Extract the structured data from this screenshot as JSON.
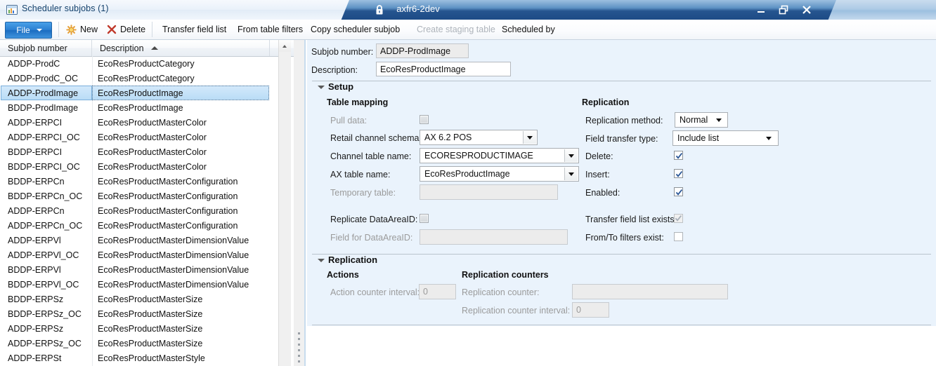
{
  "window": {
    "inner_title": "Scheduler subjobs (1)",
    "document_title": "axfr6-2dev",
    "icons": {
      "app": "window-icon",
      "lock": "lock-icon",
      "minimize": "minimize-icon",
      "maximize": "maximize-icon",
      "close": "close-icon"
    }
  },
  "toolbar": {
    "file_label": "File",
    "items": [
      {
        "label": "New",
        "icon": "new-star-icon",
        "disabled": false
      },
      {
        "label": "Delete",
        "icon": "delete-x-icon",
        "disabled": false
      },
      {
        "label": "Transfer field list",
        "icon": "",
        "disabled": false
      },
      {
        "label": "From table filters",
        "icon": "",
        "disabled": false
      },
      {
        "label": "Copy scheduler subjob",
        "icon": "",
        "disabled": false
      },
      {
        "label": "Create staging table",
        "icon": "",
        "disabled": true
      },
      {
        "label": "Scheduled by",
        "icon": "",
        "disabled": false
      }
    ]
  },
  "grid": {
    "columns": [
      {
        "label": "Subjob number",
        "sorted": false
      },
      {
        "label": "Description",
        "sorted": true,
        "sort_dir": "asc"
      }
    ],
    "selected_index": 2,
    "rows": [
      {
        "subjob": "ADDP-ProdC",
        "description": "EcoResProductCategory"
      },
      {
        "subjob": "ADDP-ProdC_OC",
        "description": "EcoResProductCategory"
      },
      {
        "subjob": "ADDP-ProdImage",
        "description": "EcoResProductImage"
      },
      {
        "subjob": "BDDP-ProdImage",
        "description": "EcoResProductImage"
      },
      {
        "subjob": "ADDP-ERPCI",
        "description": "EcoResProductMasterColor"
      },
      {
        "subjob": "ADDP-ERPCI_OC",
        "description": "EcoResProductMasterColor"
      },
      {
        "subjob": "BDDP-ERPCI",
        "description": "EcoResProductMasterColor"
      },
      {
        "subjob": "BDDP-ERPCI_OC",
        "description": "EcoResProductMasterColor"
      },
      {
        "subjob": "BDDP-ERPCn",
        "description": "EcoResProductMasterConfiguration"
      },
      {
        "subjob": "BDDP-ERPCn_OC",
        "description": "EcoResProductMasterConfiguration"
      },
      {
        "subjob": "ADDP-ERPCn",
        "description": "EcoResProductMasterConfiguration"
      },
      {
        "subjob": "ADDP-ERPCn_OC",
        "description": "EcoResProductMasterConfiguration"
      },
      {
        "subjob": "ADDP-ERPVl",
        "description": "EcoResProductMasterDimensionValue"
      },
      {
        "subjob": "ADDP-ERPVl_OC",
        "description": "EcoResProductMasterDimensionValue"
      },
      {
        "subjob": "BDDP-ERPVl",
        "description": "EcoResProductMasterDimensionValue"
      },
      {
        "subjob": "BDDP-ERPVl_OC",
        "description": "EcoResProductMasterDimensionValue"
      },
      {
        "subjob": "BDDP-ERPSz",
        "description": "EcoResProductMasterSize"
      },
      {
        "subjob": "BDDP-ERPSz_OC",
        "description": "EcoResProductMasterSize"
      },
      {
        "subjob": "ADDP-ERPSz",
        "description": "EcoResProductMasterSize"
      },
      {
        "subjob": "ADDP-ERPSz_OC",
        "description": "EcoResProductMasterSize"
      },
      {
        "subjob": "ADDP-ERPSt",
        "description": "EcoResProductMasterStyle"
      }
    ]
  },
  "detail": {
    "header": {
      "subjob_number_label": "Subjob number:",
      "subjob_number_value": "ADDP-ProdImage",
      "description_label": "Description:",
      "description_value": "EcoResProductImage"
    },
    "setup": {
      "title": "Setup",
      "table_mapping_title": "Table mapping",
      "replication_title": "Replication",
      "pull_data_label": "Pull data:",
      "pull_data_checked": false,
      "retail_channel_schema_label": "Retail channel schema:",
      "retail_channel_schema_value": "AX 6.2 POS",
      "channel_table_name_label": "Channel table name:",
      "channel_table_name_value": "ECORESPRODUCTIMAGE",
      "ax_table_name_label": "AX table name:",
      "ax_table_name_value": "EcoResProductImage",
      "temporary_table_label": "Temporary table:",
      "temporary_table_value": "",
      "replicate_dataareaid_label": "Replicate DataAreaID:",
      "replicate_dataareaid_checked": false,
      "field_for_dataareaid_label": "Field for DataAreaID:",
      "field_for_dataareaid_value": "",
      "replication_method_label": "Replication method:",
      "replication_method_value": "Normal",
      "field_transfer_type_label": "Field transfer type:",
      "field_transfer_type_value": "Include list",
      "delete_label": "Delete:",
      "delete_checked": true,
      "insert_label": "Insert:",
      "insert_checked": true,
      "enabled_label": "Enabled:",
      "enabled_checked": true,
      "transfer_field_list_exists_label": "Transfer field list exists:",
      "transfer_field_list_exists_checked": true,
      "from_to_filters_exist_label": "From/To filters exist:",
      "from_to_filters_exist_checked": false
    },
    "replication": {
      "title": "Replication",
      "actions_title": "Actions",
      "counters_title": "Replication counters",
      "action_counter_interval_label": "Action counter interval:",
      "action_counter_interval_value": "0",
      "replication_counter_label": "Replication counter:",
      "replication_counter_value": "",
      "replication_counter_interval_label": "Replication counter interval:",
      "replication_counter_interval_value": "0"
    }
  },
  "colors": {
    "accent_blue": "#1b6cc0",
    "title_blue": "#26558f",
    "pane_bg": "#eaf3fc",
    "selection": "#b9dcf6",
    "disabled_text": "#9b9b9b"
  }
}
